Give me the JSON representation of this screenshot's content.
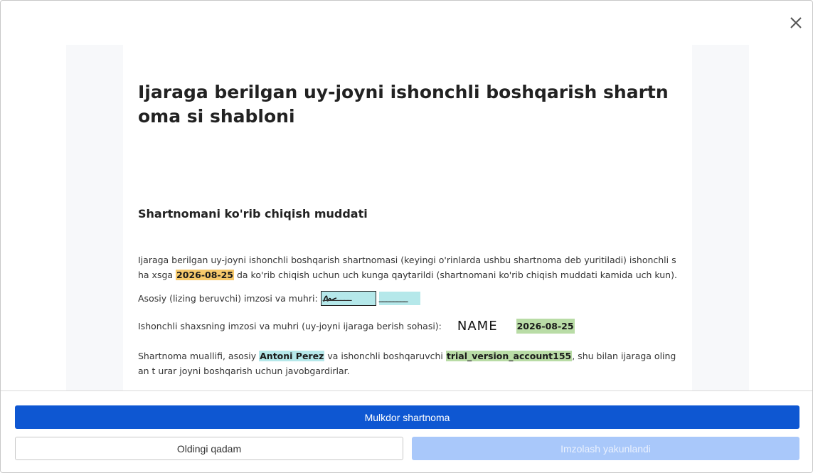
{
  "dialog": {
    "close_icon": "close-icon"
  },
  "document": {
    "title": "Ijaraga berilgan uy-joyni ishonchli boshqarish shartnoma si shabloni",
    "section_heading": "Shartnomani ko'rib chiqish muddati",
    "para1": {
      "before": "Ijaraga berilgan uy-joyni ishonchli boshqarish shartnomasi (keyingi o'rinlarda ushbu shartnoma deb yuritiladi) ishonchli sha xsga ",
      "date": "2026-08-25",
      "after": " da ko'rib chiqish uchun uch kunga qaytarildi (shartnomani ko'rib chiqish muddati kamida uch kun)."
    },
    "para2": {
      "label": "Asosiy (lizing beruvchi) imzosi va muhri:",
      "signature_blank": "________",
      "stamp_blank": "________"
    },
    "para3": {
      "label": "Ishonchli shaxsning imzosi va muhri (uy-joyni ijaraga berish sohasi):",
      "name_stamp": "NAME",
      "date": "2026-08-25"
    },
    "para4": {
      "before": "Shartnoma muallifi, asosiy ",
      "principal": "Antoni Perez",
      "middle": " va ishonchli boshqaruvchi ",
      "manager": "trial_version_account155",
      "after": ", shu bilan ijaraga olingan t urar joyni boshqarish uchun javobgardirlar."
    }
  },
  "footer": {
    "primary_label": "Mulkdor shartnoma",
    "back_label": "Oldingi qadam",
    "finish_label": "Imzolash yakunlandi"
  },
  "colors": {
    "primary": "#0e57d2",
    "disabled": "#a9c8fa",
    "highlight_orange": "#f7c96b",
    "highlight_cyan": "#b5e8ea",
    "highlight_green": "#b9dca6"
  }
}
